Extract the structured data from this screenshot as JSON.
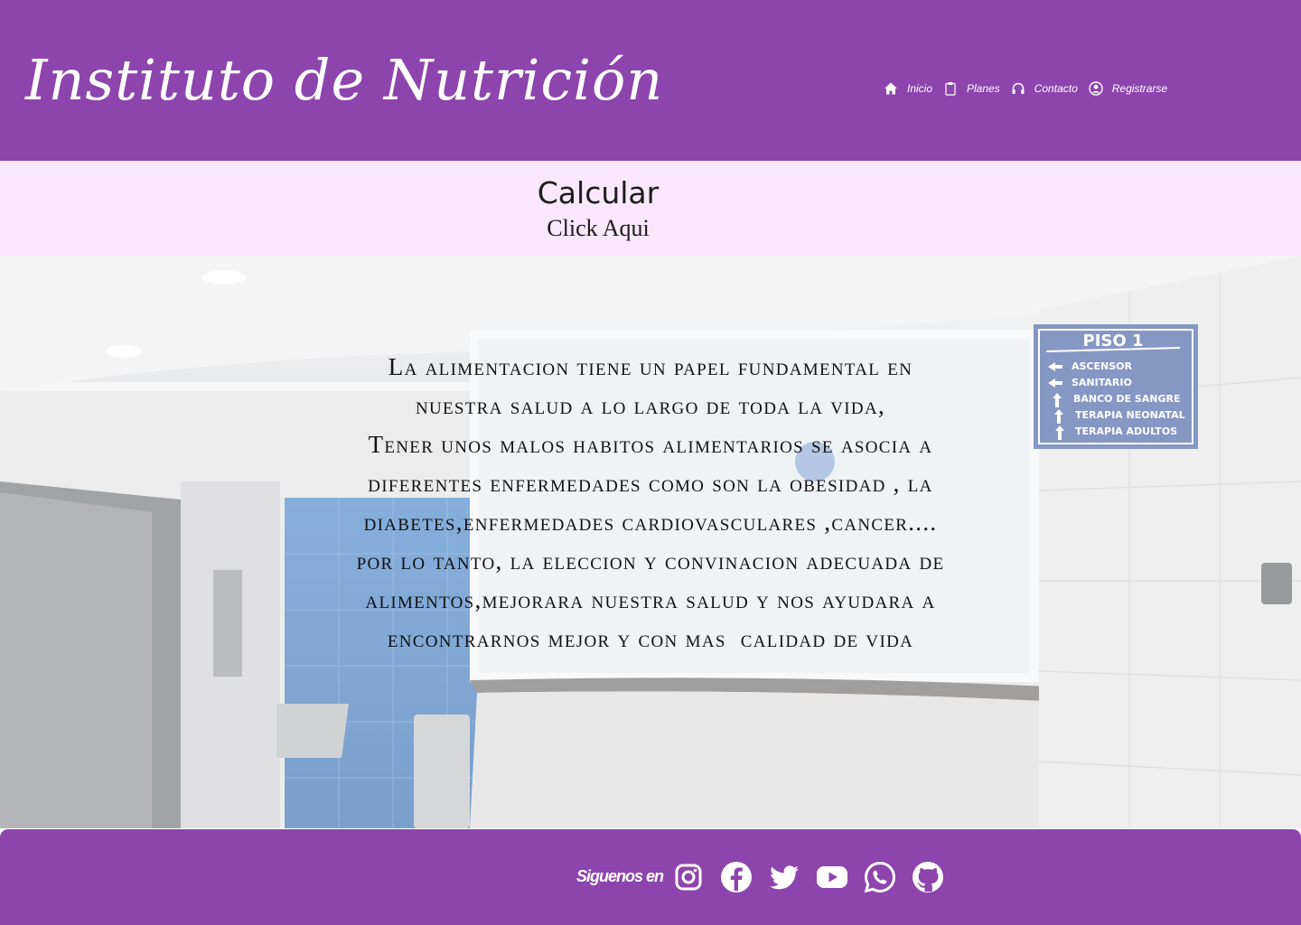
{
  "header": {
    "brand": "Instituto de Nutrición",
    "background_color": "#8e44ad",
    "nav": [
      {
        "icon": "home-icon",
        "label": "Inicio"
      },
      {
        "icon": "clipboard-icon",
        "label": "Planes"
      },
      {
        "icon": "headphones-icon",
        "label": "Contacto"
      },
      {
        "icon": "user-circle-icon",
        "label": "Registrarse"
      }
    ]
  },
  "calculator": {
    "title": "Calcular",
    "link": "Click Aqui",
    "background_color": "#f9e7fd"
  },
  "hero": {
    "lines": [
      "La alimentacion tiene un papel fundamental en",
      "nuestra salud a lo largo de toda la vida,",
      "Tener unos malos habitos alimentarios se asocia a",
      "diferentes enfermedades como son la obesidad , la",
      "diabetes,enfermedades cardiovasculares ,cancer....",
      "por lo tanto, la eleccion y convinacion adecuada de",
      "alimentos,mejorara nuestra salud y nos ayudara a",
      "encontrarnos mejor y con mas  calidad de vida"
    ],
    "sign": {
      "title": "PISO 1",
      "items": [
        "ASCENSOR",
        "SANITARIO",
        "BANCO DE SANGRE",
        "TERAPIA NEONATAL",
        "TERAPIA ADULTOS"
      ]
    }
  },
  "footer": {
    "follow_label": "Siguenos en",
    "social": [
      "instagram-icon",
      "facebook-icon",
      "twitter-icon",
      "youtube-icon",
      "whatsapp-icon",
      "github-icon"
    ]
  }
}
